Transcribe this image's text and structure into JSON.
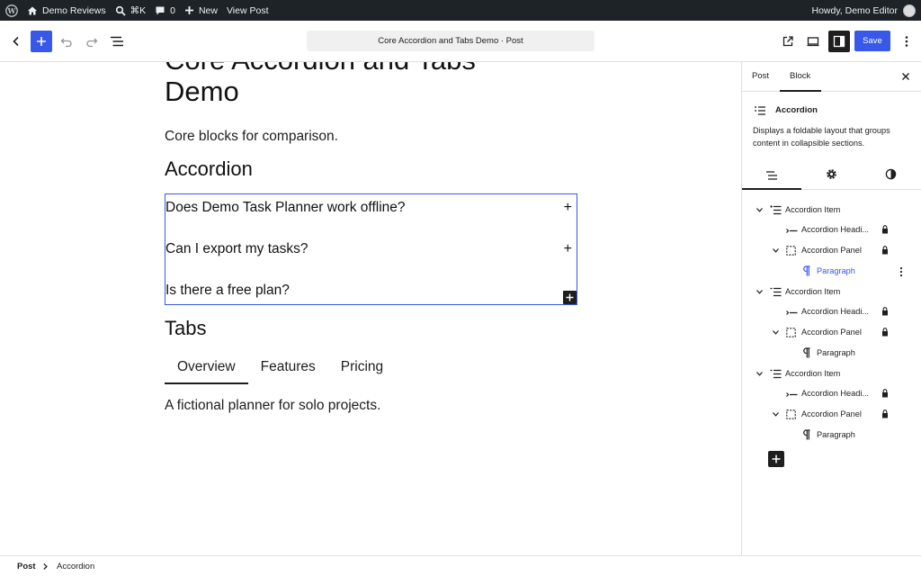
{
  "adminbar": {
    "site_name": "Demo Reviews",
    "search_shortcut": "⌘K",
    "comments_count": "0",
    "new_label": "New",
    "view_post": "View Post",
    "howdy": "Howdy, Demo Editor"
  },
  "header": {
    "document_title": "Core Accordion and Tabs Demo · Post",
    "save_label": "Save"
  },
  "canvas": {
    "title": "Core Accordion and Tabs Demo",
    "intro": "Core blocks for comparison.",
    "accordion_heading": "Accordion",
    "accordion_items": [
      "Does Demo Task Planner work offline?",
      "Can I export my tasks?",
      "Is there a free plan?"
    ],
    "accordion_toggle": "+",
    "tabs_heading": "Tabs",
    "tabs": [
      "Overview",
      "Features",
      "Pricing"
    ],
    "tab_content": "A fictional planner for solo projects."
  },
  "sidebar": {
    "tab_post": "Post",
    "tab_block": "Block",
    "block_name": "Accordion",
    "block_description": "Displays a foldable layout that groups content in collapsible sections.",
    "list_view": {
      "item": "Accordion Item",
      "heading": "Accordion Headi...",
      "panel": "Accordion Panel",
      "paragraph": "Paragraph"
    }
  },
  "footer": {
    "crumb_root": "Post",
    "crumb_current": "Accordion"
  },
  "colors": {
    "accent": "#3858e9",
    "adminbar": "#1d2327"
  }
}
